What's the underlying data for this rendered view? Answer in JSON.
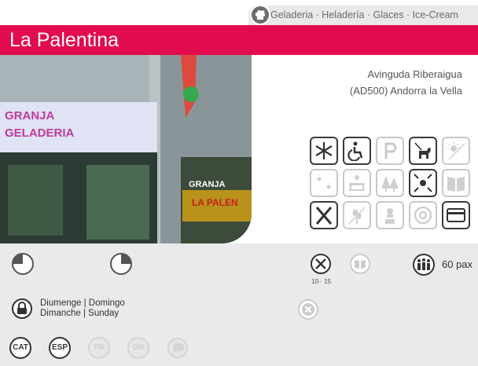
{
  "category": {
    "icon": "chef-hat-icon",
    "label": "Geladeria · Heladería · Glaces · Ice-Cream"
  },
  "title": "La Palentina",
  "photo": {
    "sign_main_1": "GRANJA",
    "sign_main_2": "GELADERIA",
    "sign_window_1": "GRANJA",
    "sign_window_2": "LA PALEN"
  },
  "address": {
    "line1": "Avinguda Riberaigua",
    "line2": "(AD500) Andorra la Vella"
  },
  "services": [
    {
      "icon": "snowflake-icon",
      "active": true
    },
    {
      "icon": "wheelchair-icon",
      "active": true
    },
    {
      "icon": "parking-icon",
      "active": false
    },
    {
      "icon": "dog-icon",
      "active": true
    },
    {
      "icon": "sun-off-icon",
      "active": false
    },
    {
      "icon": "terrace-sun-icon",
      "active": false
    },
    {
      "icon": "bench-icon",
      "active": false
    },
    {
      "icon": "trees-icon",
      "active": false
    },
    {
      "icon": "center-icon",
      "active": true
    },
    {
      "icon": "menu-book-icon",
      "active": false
    },
    {
      "icon": "cutlery-icon",
      "active": true
    },
    {
      "icon": "gluten-free-icon",
      "active": false
    },
    {
      "icon": "chef-icon",
      "active": false
    },
    {
      "icon": "at-icon",
      "active": false
    },
    {
      "icon": "credit-card-icon",
      "active": true
    }
  ],
  "info": {
    "price_min": "10",
    "price_max": "15",
    "price_sep": "-",
    "capacity": "60 pax",
    "closed_line1": "Diumenge | Domingo",
    "closed_line2": "Dimanche | Sunday"
  },
  "languages": [
    {
      "code": "CAT",
      "active": true
    },
    {
      "code": "ESP",
      "active": true
    },
    {
      "code": "FR",
      "active": false
    },
    {
      "code": "GB",
      "active": false
    },
    {
      "code": "",
      "active": false
    }
  ],
  "colors": {
    "brand": "#e30b4f",
    "panel": "#eaeaea",
    "active_icon": "#3a3a3a",
    "inactive_icon": "#c8c8c8"
  }
}
